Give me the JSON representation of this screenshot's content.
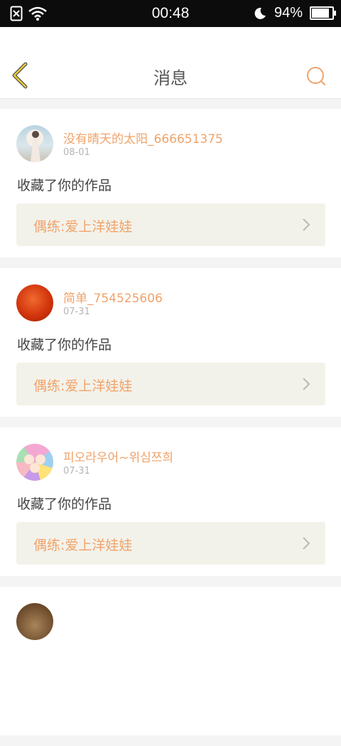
{
  "status_bar": {
    "time": "00:48",
    "battery_text": "94%",
    "battery_level": 0.94
  },
  "header": {
    "title": "消息"
  },
  "messages": [
    {
      "username": "没有晴天的太阳_666651375",
      "date": "08-01",
      "action": "收藏了你的作品",
      "work_title": "偶练:爱上洋娃娃"
    },
    {
      "username": "简单_754525606",
      "date": "07-31",
      "action": "收藏了你的作品",
      "work_title": "偶练:爱上洋娃娃"
    },
    {
      "username": "피오라우어~위심쯔희",
      "date": "07-31",
      "action": "收藏了你的作品",
      "work_title": "偶练:爱上洋娃娃"
    }
  ],
  "colors": {
    "accent": "#f0a36b",
    "back_icon": "#e8c83a",
    "card_link_bg": "#f3f2ea"
  }
}
